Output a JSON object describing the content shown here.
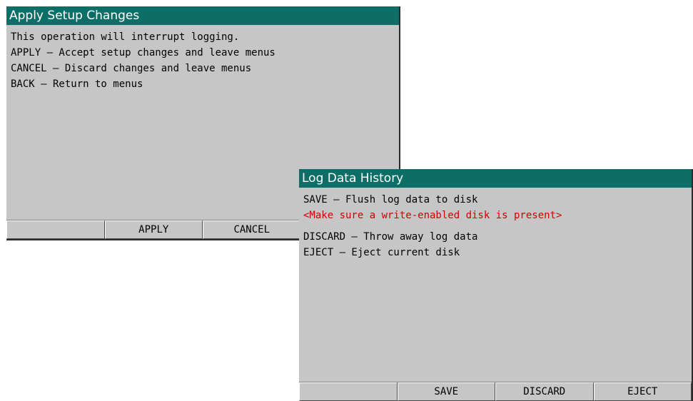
{
  "apply_dialog": {
    "title": "Apply Setup Changes",
    "lines": [
      "This operation will interrupt logging.",
      "APPLY – Accept setup changes and leave menus",
      "CANCEL – Discard changes and leave menus",
      "BACK – Return to menus"
    ],
    "softkeys": [
      "",
      "APPLY",
      "CANCEL",
      ""
    ]
  },
  "log_dialog": {
    "title": "Log Data History",
    "lines": [
      "SAVE – Flush log data to disk",
      "<Make sure a write-enabled disk is present>",
      "DISCARD – Throw away log data",
      "EJECT – Eject current disk"
    ],
    "softkeys": [
      "",
      "SAVE",
      "DISCARD",
      "EJECT"
    ]
  },
  "colors": {
    "titlebar_bg": "#0d6e67",
    "panel_bg": "#c6c6c6",
    "warning_text": "#d00000"
  }
}
